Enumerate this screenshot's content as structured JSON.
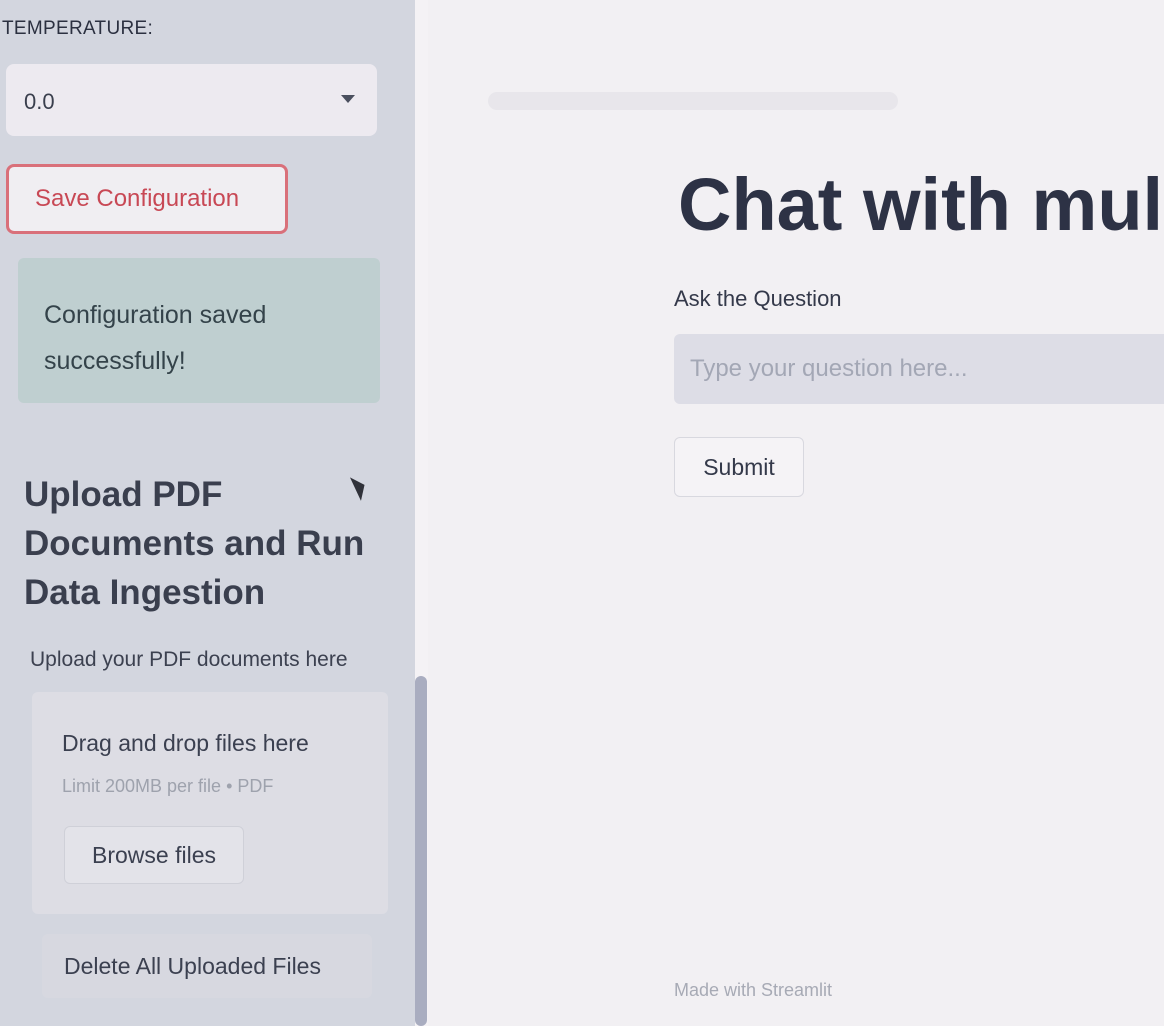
{
  "sidebar": {
    "temperature_label": "TEMPERATURE:",
    "temperature_select": {
      "value": "0.0"
    },
    "save_button_label": "Save Configuration",
    "success_message": "Configuration saved successfully!",
    "upload_heading": "Upload PDF Documents and Run Data Ingestion",
    "upload_label": "Upload your PDF documents here",
    "dropzone": {
      "title": "Drag and drop files here",
      "limit": "Limit 200MB per file • PDF",
      "browse_label": "Browse files"
    },
    "delete_button_label": "Delete All Uploaded Files"
  },
  "main": {
    "title": "Chat with mul",
    "question_label": "Ask the Question",
    "question_placeholder": "Type your question here...",
    "submit_label": "Submit",
    "footer": "Made with Streamlit"
  }
}
